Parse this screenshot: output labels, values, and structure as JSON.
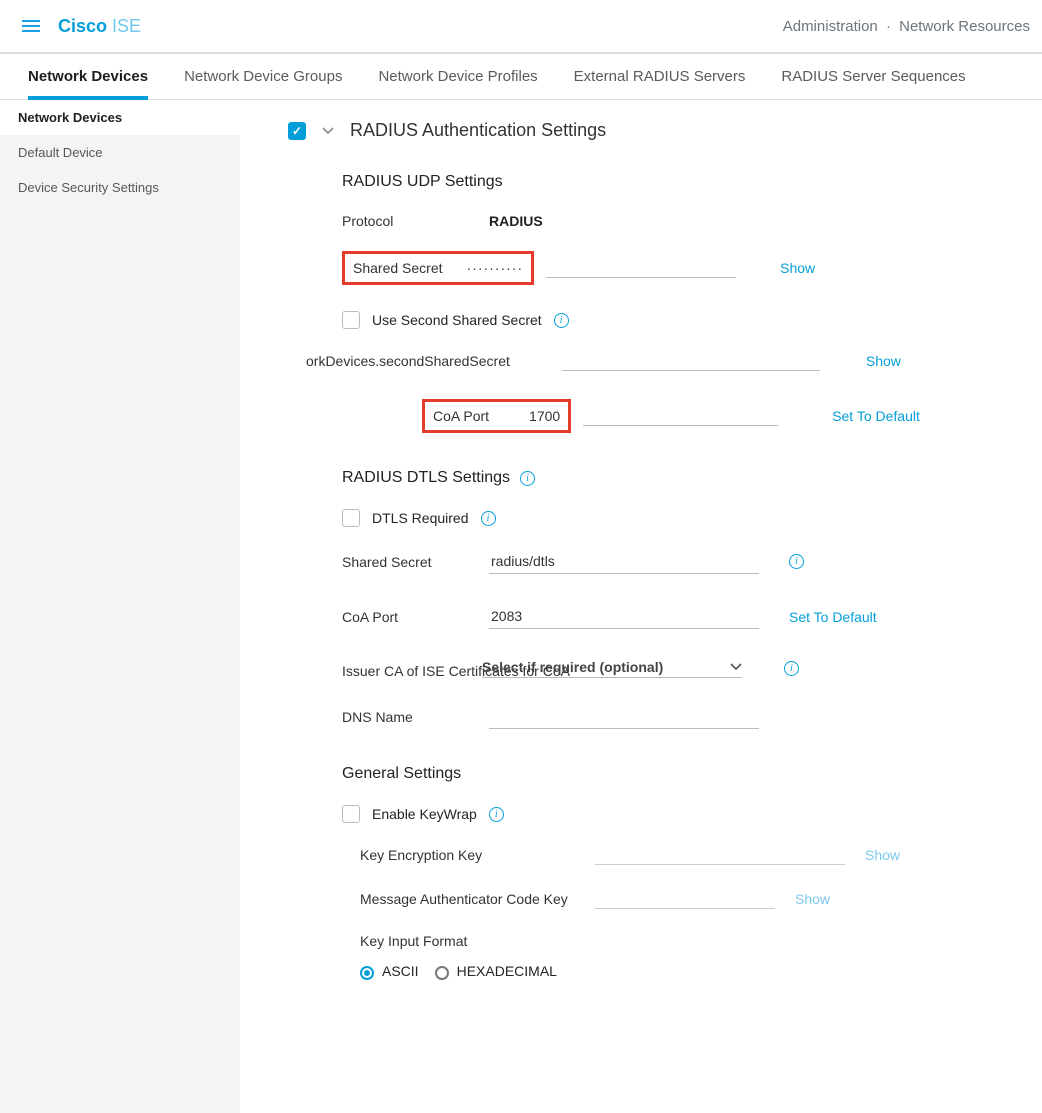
{
  "header": {
    "brand_cisco": "Cisco",
    "brand_ise": "ISE",
    "breadcrumb1": "Administration",
    "breadcrumb2": "Network Resources"
  },
  "tabs": [
    {
      "label": "Network Devices",
      "active": true
    },
    {
      "label": "Network Device Groups"
    },
    {
      "label": "Network Device Profiles"
    },
    {
      "label": "External RADIUS Servers"
    },
    {
      "label": "RADIUS Server Sequences"
    }
  ],
  "sidebar": [
    {
      "label": "Network Devices",
      "active": true
    },
    {
      "label": "Default Device"
    },
    {
      "label": "Device Security Settings"
    }
  ],
  "radius": {
    "section_title": "RADIUS Authentication Settings",
    "udp_title": "RADIUS UDP Settings",
    "protocol_label": "Protocol",
    "protocol_value": "RADIUS",
    "shared_secret_label": "Shared Secret",
    "shared_secret_value": "··········",
    "show_link": "Show",
    "use_second_label": "Use Second Shared Secret",
    "second_secret_trunc": "orkDevices.secondSharedSecret",
    "coa_port_label": "CoA Port",
    "coa_port_value": "1700",
    "set_default": "Set To Default",
    "dtls_title": "RADIUS DTLS Settings",
    "dtls_required_label": "DTLS Required",
    "dtls_secret_label": "Shared Secret",
    "dtls_secret_value": "radius/dtls",
    "dtls_coa_label": "CoA Port",
    "dtls_coa_value": "2083",
    "issuer_label": "Issuer CA of ISE Certificates for CoA",
    "issuer_placeholder": "Select if required (optional)",
    "dns_label": "DNS Name",
    "general_title": "General Settings",
    "keywrap_label": "Enable KeyWrap",
    "kek_label": "Key Encryption Key",
    "mack_label": "Message Authenticator Code Key",
    "keyinput_label": "Key Input Format",
    "ascii_label": "ASCII",
    "hex_label": "HEXADECIMAL"
  }
}
